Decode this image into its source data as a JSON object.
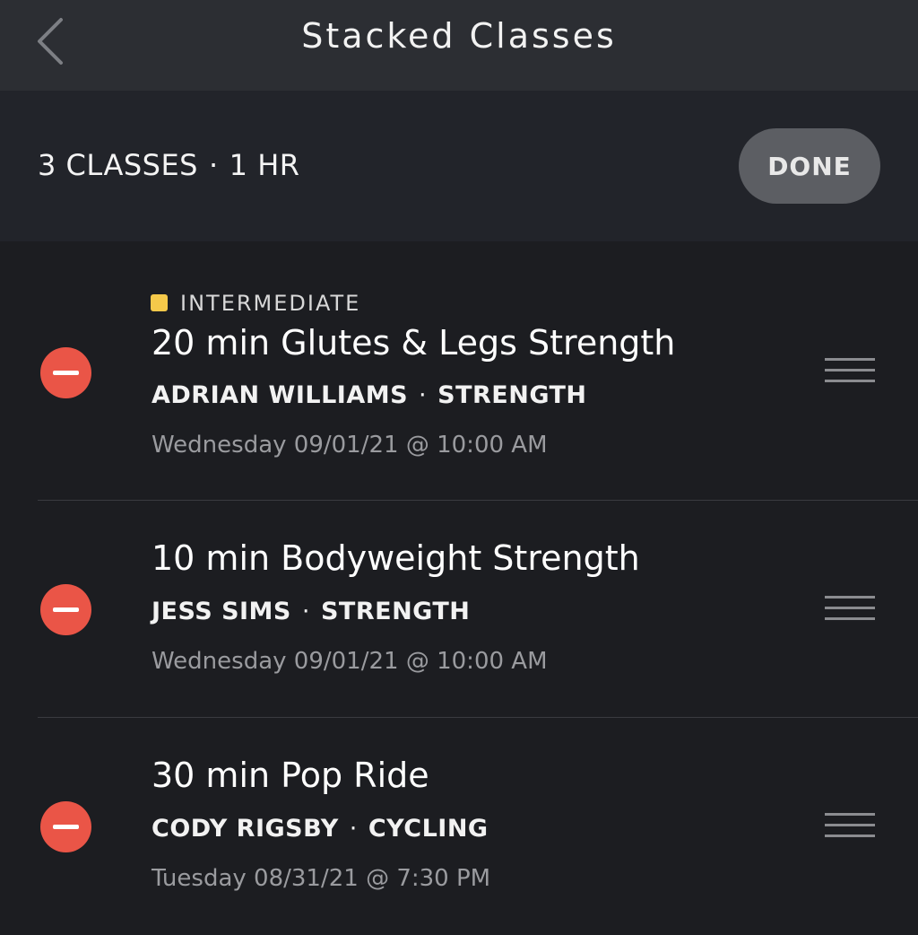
{
  "nav": {
    "title": "Stacked Classes",
    "back_icon": "chevron-left-icon"
  },
  "summary": {
    "count": "3 CLASSES",
    "separator": "·",
    "duration": "1 HR",
    "done_label": "DONE"
  },
  "classes": [
    {
      "level": "INTERMEDIATE",
      "level_color": "#f5c94a",
      "title": "20 min Glutes & Legs Strength",
      "instructor": "ADRIAN WILLIAMS",
      "separator": "·",
      "category": "STRENGTH",
      "date": "Wednesday 09/01/21 @ 10:00 AM"
    },
    {
      "title": "10 min Bodyweight Strength",
      "instructor": "JESS SIMS",
      "separator": "·",
      "category": "STRENGTH",
      "date": "Wednesday 09/01/21 @ 10:00 AM"
    },
    {
      "title": "30 min Pop Ride",
      "instructor": "CODY RIGSBY",
      "separator": "·",
      "category": "CYCLING",
      "date": "Tuesday 08/31/21 @ 7:30 PM"
    }
  ],
  "colors": {
    "remove": "#ea5547",
    "navbar": "#2c2e33",
    "background": "#1c1d21",
    "done_button": "#5c5e63"
  }
}
